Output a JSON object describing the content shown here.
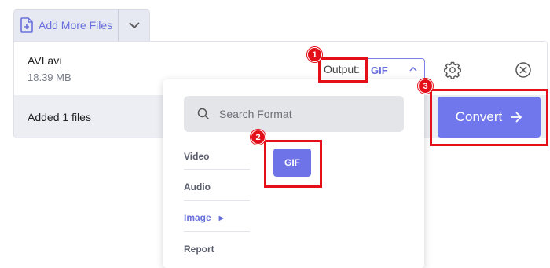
{
  "toolbar": {
    "add_files_label": "Add More Files",
    "add_files_icon": "file-plus-icon",
    "dropdown_icon": "chevron-down-icon"
  },
  "file": {
    "name": "AVI.avi",
    "size": "18.39 MB"
  },
  "status": {
    "added_text": "Added 1 files"
  },
  "output": {
    "label": "Output:",
    "selected": "GIF"
  },
  "format_dropdown": {
    "search_placeholder": "Search Format",
    "categories": [
      {
        "label": "Video"
      },
      {
        "label": "Audio"
      },
      {
        "label": "Image",
        "active": true
      },
      {
        "label": "Report"
      }
    ],
    "formats": [
      "GIF"
    ]
  },
  "convert": {
    "label": "Convert"
  },
  "annotations": {
    "step1": "1",
    "step2": "2",
    "step3": "3",
    "color": "#e3101a"
  },
  "colors": {
    "accent": "#6e74e8",
    "panel_bg": "#eceef4"
  }
}
